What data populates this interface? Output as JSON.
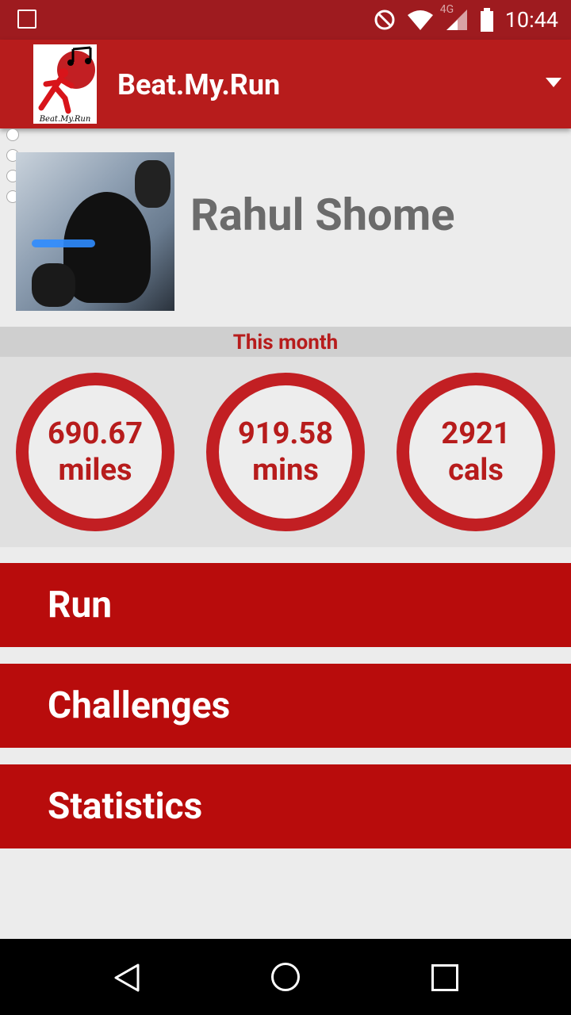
{
  "status_bar": {
    "network": "4G",
    "time": "10:44",
    "icons": [
      "image-icon",
      "do-not-disturb-icon",
      "wifi-icon",
      "signal-icon",
      "battery-icon"
    ]
  },
  "app_bar": {
    "title": "Beat.My.Run",
    "logo_text": "Beat.My.Run"
  },
  "profile": {
    "name": "Rahul Shome"
  },
  "month_section": {
    "label": "This month",
    "stats": [
      {
        "value": "690.67",
        "unit": "miles"
      },
      {
        "value": "919.58",
        "unit": "mins"
      },
      {
        "value": "2921",
        "unit": "cals"
      }
    ]
  },
  "menu": {
    "run": "Run",
    "challenges": "Challenges",
    "statistics": "Statistics"
  },
  "colors": {
    "primary": "#b71c1c",
    "status_bar": "#9e1b1f",
    "button": "#b80c0c",
    "background": "#ececec"
  }
}
